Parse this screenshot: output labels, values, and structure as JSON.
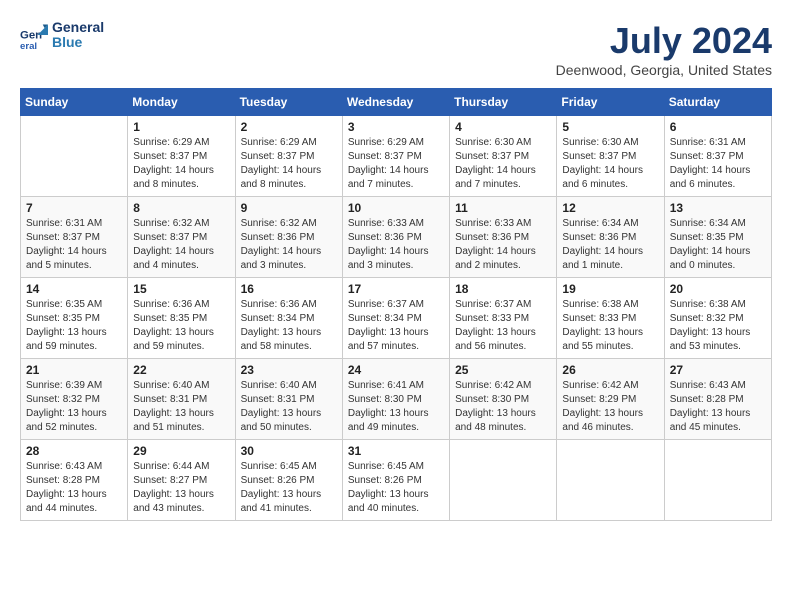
{
  "header": {
    "logo_line1": "General",
    "logo_line2": "Blue",
    "title": "July 2024",
    "subtitle": "Deenwood, Georgia, United States"
  },
  "days_of_week": [
    "Sunday",
    "Monday",
    "Tuesday",
    "Wednesday",
    "Thursday",
    "Friday",
    "Saturday"
  ],
  "weeks": [
    [
      {
        "day": "",
        "info": ""
      },
      {
        "day": "1",
        "info": "Sunrise: 6:29 AM\nSunset: 8:37 PM\nDaylight: 14 hours\nand 8 minutes."
      },
      {
        "day": "2",
        "info": "Sunrise: 6:29 AM\nSunset: 8:37 PM\nDaylight: 14 hours\nand 8 minutes."
      },
      {
        "day": "3",
        "info": "Sunrise: 6:29 AM\nSunset: 8:37 PM\nDaylight: 14 hours\nand 7 minutes."
      },
      {
        "day": "4",
        "info": "Sunrise: 6:30 AM\nSunset: 8:37 PM\nDaylight: 14 hours\nand 7 minutes."
      },
      {
        "day": "5",
        "info": "Sunrise: 6:30 AM\nSunset: 8:37 PM\nDaylight: 14 hours\nand 6 minutes."
      },
      {
        "day": "6",
        "info": "Sunrise: 6:31 AM\nSunset: 8:37 PM\nDaylight: 14 hours\nand 6 minutes."
      }
    ],
    [
      {
        "day": "7",
        "info": "Sunrise: 6:31 AM\nSunset: 8:37 PM\nDaylight: 14 hours\nand 5 minutes."
      },
      {
        "day": "8",
        "info": "Sunrise: 6:32 AM\nSunset: 8:37 PM\nDaylight: 14 hours\nand 4 minutes."
      },
      {
        "day": "9",
        "info": "Sunrise: 6:32 AM\nSunset: 8:36 PM\nDaylight: 14 hours\nand 3 minutes."
      },
      {
        "day": "10",
        "info": "Sunrise: 6:33 AM\nSunset: 8:36 PM\nDaylight: 14 hours\nand 3 minutes."
      },
      {
        "day": "11",
        "info": "Sunrise: 6:33 AM\nSunset: 8:36 PM\nDaylight: 14 hours\nand 2 minutes."
      },
      {
        "day": "12",
        "info": "Sunrise: 6:34 AM\nSunset: 8:36 PM\nDaylight: 14 hours\nand 1 minute."
      },
      {
        "day": "13",
        "info": "Sunrise: 6:34 AM\nSunset: 8:35 PM\nDaylight: 14 hours\nand 0 minutes."
      }
    ],
    [
      {
        "day": "14",
        "info": "Sunrise: 6:35 AM\nSunset: 8:35 PM\nDaylight: 13 hours\nand 59 minutes."
      },
      {
        "day": "15",
        "info": "Sunrise: 6:36 AM\nSunset: 8:35 PM\nDaylight: 13 hours\nand 59 minutes."
      },
      {
        "day": "16",
        "info": "Sunrise: 6:36 AM\nSunset: 8:34 PM\nDaylight: 13 hours\nand 58 minutes."
      },
      {
        "day": "17",
        "info": "Sunrise: 6:37 AM\nSunset: 8:34 PM\nDaylight: 13 hours\nand 57 minutes."
      },
      {
        "day": "18",
        "info": "Sunrise: 6:37 AM\nSunset: 8:33 PM\nDaylight: 13 hours\nand 56 minutes."
      },
      {
        "day": "19",
        "info": "Sunrise: 6:38 AM\nSunset: 8:33 PM\nDaylight: 13 hours\nand 55 minutes."
      },
      {
        "day": "20",
        "info": "Sunrise: 6:38 AM\nSunset: 8:32 PM\nDaylight: 13 hours\nand 53 minutes."
      }
    ],
    [
      {
        "day": "21",
        "info": "Sunrise: 6:39 AM\nSunset: 8:32 PM\nDaylight: 13 hours\nand 52 minutes."
      },
      {
        "day": "22",
        "info": "Sunrise: 6:40 AM\nSunset: 8:31 PM\nDaylight: 13 hours\nand 51 minutes."
      },
      {
        "day": "23",
        "info": "Sunrise: 6:40 AM\nSunset: 8:31 PM\nDaylight: 13 hours\nand 50 minutes."
      },
      {
        "day": "24",
        "info": "Sunrise: 6:41 AM\nSunset: 8:30 PM\nDaylight: 13 hours\nand 49 minutes."
      },
      {
        "day": "25",
        "info": "Sunrise: 6:42 AM\nSunset: 8:30 PM\nDaylight: 13 hours\nand 48 minutes."
      },
      {
        "day": "26",
        "info": "Sunrise: 6:42 AM\nSunset: 8:29 PM\nDaylight: 13 hours\nand 46 minutes."
      },
      {
        "day": "27",
        "info": "Sunrise: 6:43 AM\nSunset: 8:28 PM\nDaylight: 13 hours\nand 45 minutes."
      }
    ],
    [
      {
        "day": "28",
        "info": "Sunrise: 6:43 AM\nSunset: 8:28 PM\nDaylight: 13 hours\nand 44 minutes."
      },
      {
        "day": "29",
        "info": "Sunrise: 6:44 AM\nSunset: 8:27 PM\nDaylight: 13 hours\nand 43 minutes."
      },
      {
        "day": "30",
        "info": "Sunrise: 6:45 AM\nSunset: 8:26 PM\nDaylight: 13 hours\nand 41 minutes."
      },
      {
        "day": "31",
        "info": "Sunrise: 6:45 AM\nSunset: 8:26 PM\nDaylight: 13 hours\nand 40 minutes."
      },
      {
        "day": "",
        "info": ""
      },
      {
        "day": "",
        "info": ""
      },
      {
        "day": "",
        "info": ""
      }
    ]
  ]
}
